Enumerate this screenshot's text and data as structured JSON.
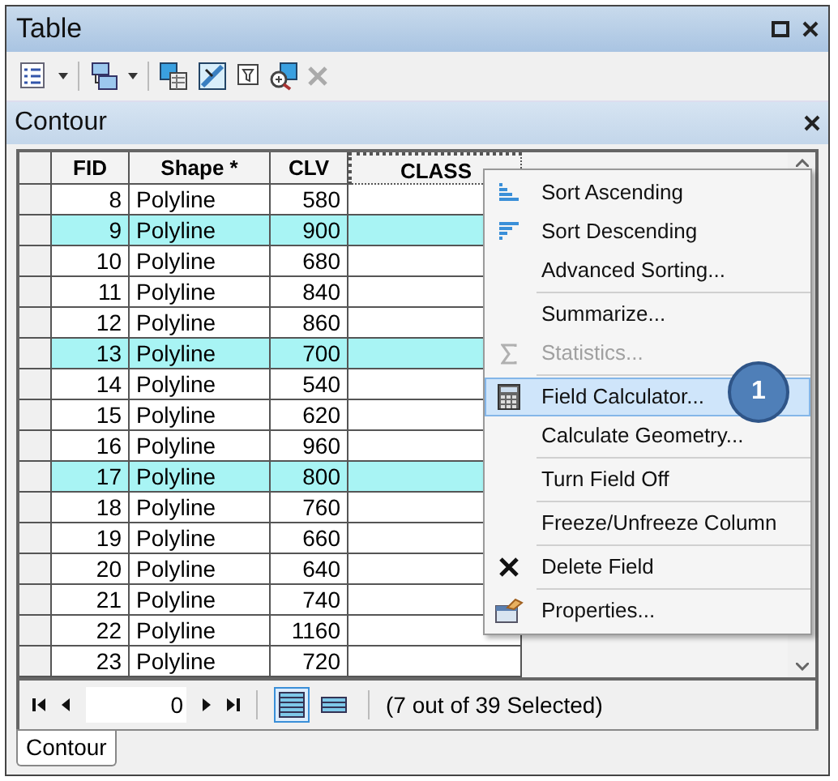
{
  "window": {
    "title": "Table"
  },
  "table_title": "Contour",
  "table": {
    "columns": [
      "FID",
      "Shape *",
      "CLV",
      "CLASS"
    ],
    "rows": [
      {
        "cells": [
          "8",
          "Polyline",
          "580",
          ""
        ],
        "selected": false
      },
      {
        "cells": [
          "9",
          "Polyline",
          "900",
          ""
        ],
        "selected": true
      },
      {
        "cells": [
          "10",
          "Polyline",
          "680",
          ""
        ],
        "selected": false
      },
      {
        "cells": [
          "11",
          "Polyline",
          "840",
          ""
        ],
        "selected": false
      },
      {
        "cells": [
          "12",
          "Polyline",
          "860",
          ""
        ],
        "selected": false
      },
      {
        "cells": [
          "13",
          "Polyline",
          "700",
          ""
        ],
        "selected": true
      },
      {
        "cells": [
          "14",
          "Polyline",
          "540",
          ""
        ],
        "selected": false
      },
      {
        "cells": [
          "15",
          "Polyline",
          "620",
          ""
        ],
        "selected": false
      },
      {
        "cells": [
          "16",
          "Polyline",
          "960",
          ""
        ],
        "selected": false
      },
      {
        "cells": [
          "17",
          "Polyline",
          "800",
          ""
        ],
        "selected": true
      },
      {
        "cells": [
          "18",
          "Polyline",
          "760",
          ""
        ],
        "selected": false
      },
      {
        "cells": [
          "19",
          "Polyline",
          "660",
          ""
        ],
        "selected": false
      },
      {
        "cells": [
          "20",
          "Polyline",
          "640",
          ""
        ],
        "selected": false
      },
      {
        "cells": [
          "21",
          "Polyline",
          "740",
          ""
        ],
        "selected": false
      },
      {
        "cells": [
          "22",
          "Polyline",
          "1160",
          ""
        ],
        "selected": false
      },
      {
        "cells": [
          "23",
          "Polyline",
          "720",
          ""
        ],
        "selected": false
      }
    ]
  },
  "context_menu": [
    {
      "label": "Sort Ascending",
      "kind": "sort-asc",
      "disabled": false,
      "selected": false,
      "separator_after": false
    },
    {
      "label": "Sort Descending",
      "kind": "sort-desc",
      "disabled": false,
      "selected": false,
      "separator_after": false
    },
    {
      "label": "Advanced Sorting...",
      "kind": "plain",
      "disabled": false,
      "selected": false,
      "separator_after": true
    },
    {
      "label": "Summarize...",
      "kind": "plain",
      "disabled": false,
      "selected": false,
      "separator_after": false
    },
    {
      "label": "Statistics...",
      "kind": "sigma",
      "disabled": true,
      "selected": false,
      "separator_after": true
    },
    {
      "label": "Field Calculator...",
      "kind": "calculator",
      "disabled": false,
      "selected": true,
      "separator_after": false
    },
    {
      "label": "Calculate Geometry...",
      "kind": "plain",
      "disabled": false,
      "selected": false,
      "separator_after": true
    },
    {
      "label": "Turn Field Off",
      "kind": "plain",
      "disabled": false,
      "selected": false,
      "separator_after": true
    },
    {
      "label": "Freeze/Unfreeze Column",
      "kind": "plain",
      "disabled": false,
      "selected": false,
      "separator_after": true
    },
    {
      "label": "Delete Field",
      "kind": "delete",
      "disabled": false,
      "selected": false,
      "separator_after": true
    },
    {
      "label": "Properties...",
      "kind": "properties",
      "disabled": false,
      "selected": false,
      "separator_after": false
    }
  ],
  "callout": "1",
  "footer": {
    "record": "0",
    "views": [
      {
        "kind": "all",
        "selected": true
      },
      {
        "kind": "selected",
        "selected": false
      }
    ],
    "status": "(7 out of 39 Selected)"
  },
  "tabs": [
    {
      "label": "Contour",
      "selected": true
    }
  ]
}
